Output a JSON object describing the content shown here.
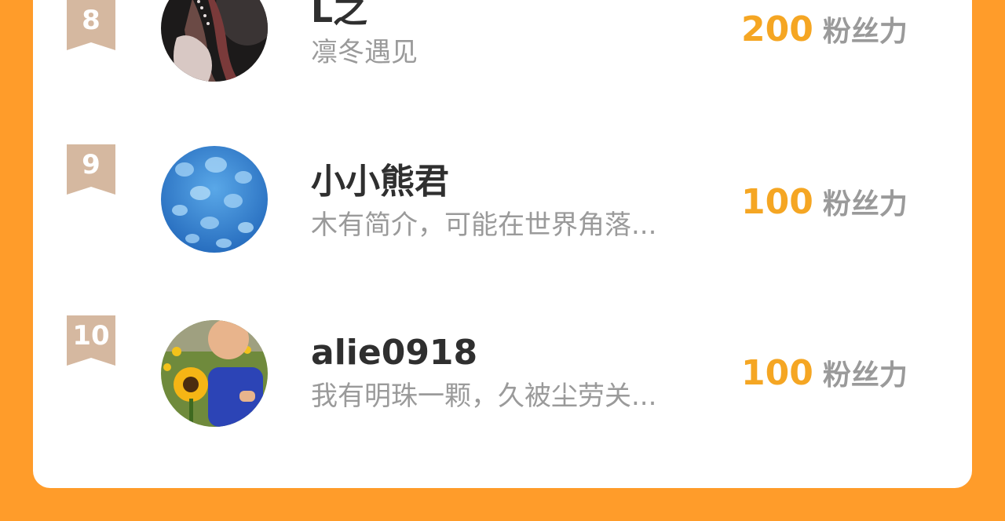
{
  "colors": {
    "background": "#ff9c2a",
    "card": "#ffffff",
    "score": "#f5a623",
    "rank_badge": "#d5b8a0"
  },
  "ranking": [
    {
      "rank": "8",
      "name": "L之",
      "description": "凛冬遇见",
      "score": "200",
      "unit": "粉丝力",
      "avatar_icon": "dark-portrait-avatar"
    },
    {
      "rank": "9",
      "name": "小小熊君",
      "description": "木有简介，可能在世界角落...",
      "score": "100",
      "unit": "粉丝力",
      "avatar_icon": "jellyfish-avatar"
    },
    {
      "rank": "10",
      "name": "alie0918",
      "description": "我有明珠一颗，久被尘劳关...",
      "score": "100",
      "unit": "粉丝力",
      "avatar_icon": "baby-sunflower-avatar"
    }
  ]
}
